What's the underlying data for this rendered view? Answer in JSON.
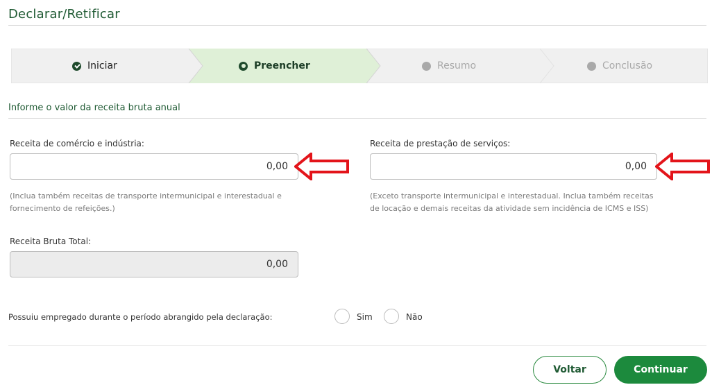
{
  "header": {
    "title": "Declarar/Retificar"
  },
  "stepper": {
    "steps": [
      {
        "label": "Iniciar",
        "state": "done"
      },
      {
        "label": "Preencher",
        "state": "active"
      },
      {
        "label": "Resumo",
        "state": "pending"
      },
      {
        "label": "Conclusão",
        "state": "pending"
      }
    ]
  },
  "section": {
    "title": "Informe o valor da receita bruta anual"
  },
  "form": {
    "comercio": {
      "label": "Receita de comércio e indústria:",
      "value": "0,00",
      "help_line1": "(Inclua também receitas de transporte intermunicipal e interestadual e",
      "help_line2": "fornecimento de refeições.)"
    },
    "servicos": {
      "label": "Receita de prestação de serviços:",
      "value": "0,00",
      "help_line1": "(Exceto transporte intermunicipal e interestadual. Inclua também receitas",
      "help_line2": "de locação e demais receitas da atividade sem incidência de ICMS e ISS)"
    },
    "total": {
      "label": "Receita Bruta Total:",
      "value": "0,00"
    },
    "empregado": {
      "question": "Possuiu empregado durante o período abrangido pela declaração:",
      "option_yes": "Sim",
      "option_no": "Não"
    }
  },
  "actions": {
    "back_label": "Voltar",
    "continue_label": "Continuar"
  },
  "colors": {
    "brand_green": "#1c8a3d",
    "active_step_bg": "#dff0d7",
    "annotation_arrow": "#e3141a"
  }
}
